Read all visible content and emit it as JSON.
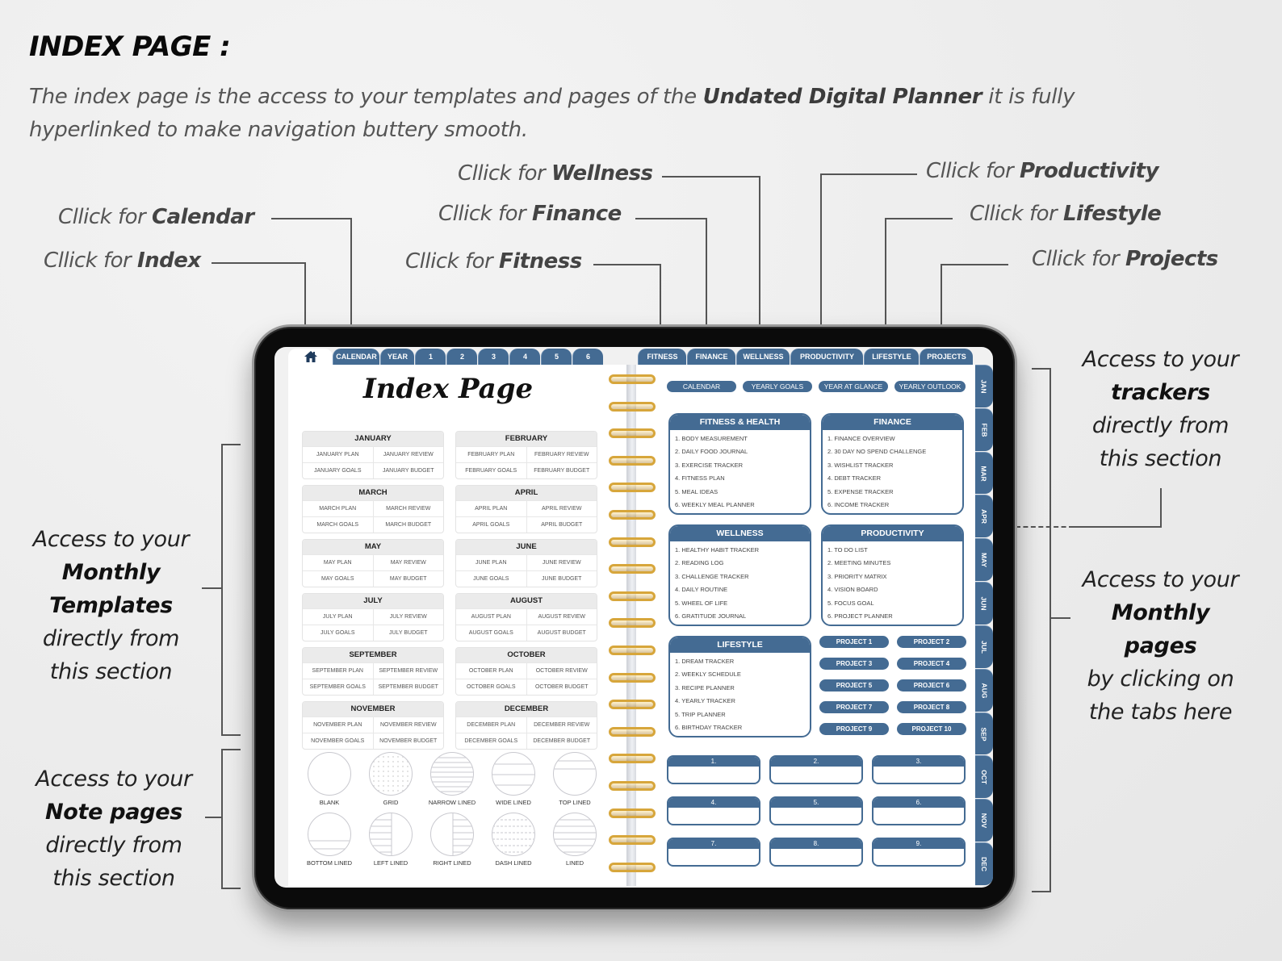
{
  "heading": "INDEX PAGE :",
  "intro": {
    "part1": "The index page is the access to your templates and pages of the ",
    "bold": "Undated Digital Planner",
    "part2": " it is fully hyperlinked to make navigation buttery smooth."
  },
  "callouts": {
    "prefix": "Cllick for ",
    "calendar": "Calendar",
    "index": "Index",
    "wellness": "Wellness",
    "finance": "Finance",
    "fitness": "Fitness",
    "productivity": "Productivity",
    "lifestyle": "Lifestyle",
    "projects": "Projects"
  },
  "side_notes": {
    "monthly_templates": {
      "l1": "Access to your",
      "bold": "Monthly Templates",
      "b1": "Monthly",
      "b2": "Templates",
      "l2": "directly from",
      "l3": "this section"
    },
    "note_pages": {
      "l1": "Access to your",
      "bold": "Note pages",
      "l2": "directly from",
      "l3": "this section"
    },
    "trackers": {
      "l1": "Access to your",
      "bold": "trackers",
      "l2": "directly from",
      "l3": "this section"
    },
    "monthly_pages": {
      "l1": "Access to your",
      "bold": "Monthly pages",
      "l2": "by clicking on",
      "l3": "the tabs here"
    }
  },
  "planner": {
    "left_tabs": [
      "CALENDAR",
      "YEAR",
      "1",
      "2",
      "3",
      "4",
      "5",
      "6"
    ],
    "right_tabs": [
      "FITNESS",
      "FINANCE",
      "WELLNESS",
      "PRODUCTIVITY",
      "LIFESTYLE",
      "PROJECTS"
    ],
    "title": "Index Page",
    "months": [
      {
        "name": "JANUARY",
        "cells": [
          "JANUARY PLAN",
          "JANUARY REVIEW",
          "JANUARY GOALS",
          "JANUARY BUDGET"
        ]
      },
      {
        "name": "FEBRUARY",
        "cells": [
          "FEBRUARY PLAN",
          "FEBRUARY REVIEW",
          "FEBRUARY GOALS",
          "FEBRUARY BUDGET"
        ]
      },
      {
        "name": "MARCH",
        "cells": [
          "MARCH PLAN",
          "MARCH REVIEW",
          "MARCH GOALS",
          "MARCH BUDGET"
        ]
      },
      {
        "name": "APRIL",
        "cells": [
          "APRIL PLAN",
          "APRIL REVIEW",
          "APRIL GOALS",
          "APRIL BUDGET"
        ]
      },
      {
        "name": "MAY",
        "cells": [
          "MAY PLAN",
          "MAY REVIEW",
          "MAY GOALS",
          "MAY BUDGET"
        ]
      },
      {
        "name": "JUNE",
        "cells": [
          "JUNE PLAN",
          "JUNE REVIEW",
          "JUNE GOALS",
          "JUNE BUDGET"
        ]
      },
      {
        "name": "JULY",
        "cells": [
          "JULY PLAN",
          "JULY REVIEW",
          "JULY GOALS",
          "JULY BUDGET"
        ]
      },
      {
        "name": "AUGUST",
        "cells": [
          "AUGUST PLAN",
          "AUGUST REVIEW",
          "AUGUST GOALS",
          "AUGUST BUDGET"
        ]
      },
      {
        "name": "SEPTEMBER",
        "cells": [
          "SEPTEMBER PLAN",
          "SEPTEMBER REVIEW",
          "SEPTEMBER GOALS",
          "SEPTEMBER BUDGET"
        ]
      },
      {
        "name": "OCTOBER",
        "cells": [
          "OCTOBER PLAN",
          "OCTOBER REVIEW",
          "OCTOBER GOALS",
          "OCTOBER BUDGET"
        ]
      },
      {
        "name": "NOVEMBER",
        "cells": [
          "NOVEMBER PLAN",
          "NOVEMBER REVIEW",
          "NOVEMBER GOALS",
          "NOVEMBER BUDGET"
        ]
      },
      {
        "name": "DECEMBER",
        "cells": [
          "DECEMBER PLAN",
          "DECEMBER REVIEW",
          "DECEMBER GOALS",
          "DECEMBER BUDGET"
        ]
      }
    ],
    "notes": [
      {
        "label": "BLANK",
        "pattern": "blank"
      },
      {
        "label": "GRID",
        "pattern": "grid"
      },
      {
        "label": "NARROW LINED",
        "pattern": "narrow"
      },
      {
        "label": "WIDE LINED",
        "pattern": "wide"
      },
      {
        "label": "TOP LINED",
        "pattern": "top"
      },
      {
        "label": "BOTTOM LINED",
        "pattern": "bottom"
      },
      {
        "label": "LEFT LINED",
        "pattern": "left"
      },
      {
        "label": "RIGHT LINED",
        "pattern": "right"
      },
      {
        "label": "DASH LINED",
        "pattern": "dash"
      },
      {
        "label": "LINED",
        "pattern": "lined"
      }
    ],
    "quick_links": [
      "CALENDAR",
      "YEARLY GOALS",
      "YEAR AT GLANCE",
      "YEARLY OUTLOOK"
    ],
    "trackers": [
      {
        "title": "FITNESS & HEALTH",
        "items": [
          "1. BODY MEASUREMENT",
          "2. DAILY FOOD JOURNAL",
          "3. EXERCISE TRACKER",
          "4. FITNESS PLAN",
          "5. MEAL IDEAS",
          "6. WEEKLY MEAL PLANNER"
        ]
      },
      {
        "title": "FINANCE",
        "items": [
          "1. FINANCE OVERVIEW",
          "2. 30 DAY NO SPEND CHALLENGE",
          "3. WISHLIST TRACKER",
          "4. DEBT TRACKER",
          "5. EXPENSE TRACKER",
          "6. INCOME TRACKER"
        ]
      },
      {
        "title": "WELLNESS",
        "items": [
          "1. HEALTHY HABIT TRACKER",
          "2. READING LOG",
          "3. CHALLENGE TRACKER",
          "4. DAILY ROUTINE",
          "5. WHEEL OF LIFE",
          "6. GRATITUDE JOURNAL"
        ]
      },
      {
        "title": "PRODUCTIVITY",
        "items": [
          "1. TO DO LIST",
          "2. MEETING MINUTES",
          "3. PRIORITY MATRIX",
          "4. VISION BOARD",
          "5. FOCUS GOAL",
          "6. PROJECT PLANNER"
        ]
      },
      {
        "title": "LIFESTYLE",
        "items": [
          "1. DREAM TRACKER",
          "2. WEEKLY SCHEDULE",
          "3. RECIPE PLANNER",
          "4. YEARLY TRACKER",
          "5. TRIP PLANNER",
          "6. BIRTHDAY TRACKER"
        ]
      }
    ],
    "projects": [
      "PROJECT 1",
      "PROJECT 2",
      "PROJECT 3",
      "PROJECT 4",
      "PROJECT 5",
      "PROJECT 6",
      "PROJECT 7",
      "PROJECT 8",
      "PROJECT 9",
      "PROJECT 10"
    ],
    "numbered_boxes": [
      "1.",
      "2.",
      "3.",
      "4.",
      "5.",
      "6.",
      "7.",
      "8.",
      "9."
    ],
    "side_tabs": [
      "JAN",
      "FEB",
      "MAR",
      "APR",
      "MAY",
      "JUN",
      "JUL",
      "AUG",
      "SEP",
      "OCT",
      "NOV",
      "DEC"
    ]
  },
  "colors": {
    "accent": "#446b93",
    "ring_gold": "#d7a63b",
    "bezel": "#0b0b0b"
  }
}
